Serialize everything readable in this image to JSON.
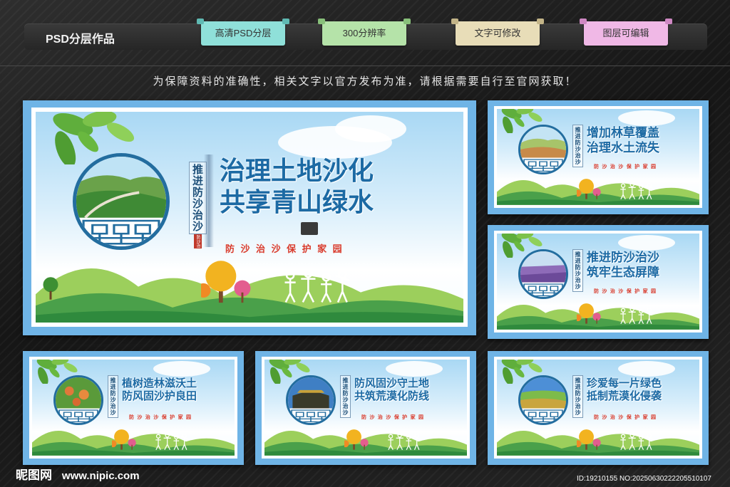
{
  "toolbar": {
    "title": "PSD分层作品",
    "tags": [
      "高清PSD分层",
      "300分辨率",
      "文字可修改",
      "图层可编辑"
    ]
  },
  "notice": "为保障资料的准确性，相关文字以官方发布为准，请根据需要自行至官网获取！",
  "vertical_label": "推进防沙治沙",
  "seal": "防沙治",
  "boards": [
    {
      "line1": "治理土地沙化",
      "line2": "共享青山绿水",
      "slogan": "防 沙 治 沙 保 护 家 园"
    },
    {
      "line1": "增加林草覆盖",
      "line2": "治理水土流失",
      "slogan": "防 沙 治 沙 保 护 家 园"
    },
    {
      "line1": "推进防沙治沙",
      "line2": "筑牢生态屏障",
      "slogan": "防 沙 治 沙 保 护 家 园"
    },
    {
      "line1": "植树造林滋沃土",
      "line2": "防风固沙护良田",
      "slogan": "防 沙 治 沙 保 护 家 园"
    },
    {
      "line1": "防风固沙守土地",
      "line2": "共筑荒漠化防线",
      "slogan": "防 沙 治 沙 保 护 家 园"
    },
    {
      "line1": "珍爱每一片绿色",
      "line2": "抵制荒漠化侵袭",
      "slogan": "防 沙 治 沙 保 护 家 园"
    }
  ],
  "footer": {
    "logo": "昵图网",
    "url": "www.nipic.com",
    "id": "ID:19210155 NO:20250630222205510107"
  },
  "colors": {
    "frame": "#6fb4e6",
    "headline": "#1c6aa4",
    "slogan": "#d93a2b",
    "ring": "#236d9f"
  }
}
